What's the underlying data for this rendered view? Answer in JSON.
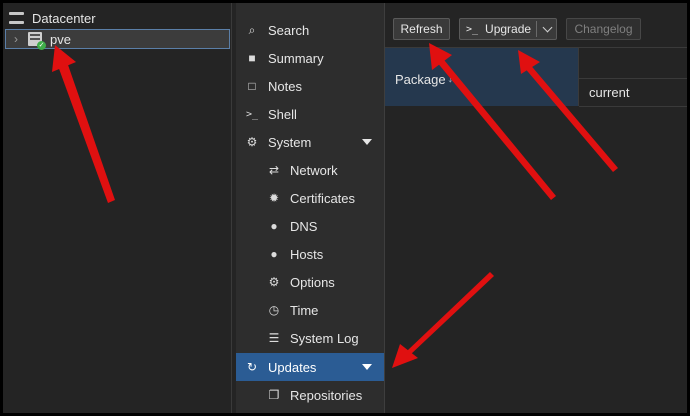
{
  "tree": {
    "datacenter_label": "Datacenter",
    "node_label": "pve",
    "expander_glyph": "›"
  },
  "nav": {
    "items": [
      {
        "label": "Search",
        "icon": "search-icon"
      },
      {
        "label": "Summary",
        "icon": "book-icon"
      },
      {
        "label": "Notes",
        "icon": "note-icon"
      },
      {
        "label": "Shell",
        "icon": "terminal-icon"
      },
      {
        "label": "System",
        "icon": "gears-icon"
      },
      {
        "label": "Network",
        "icon": "exchange-icon"
      },
      {
        "label": "Certificates",
        "icon": "certificate-icon"
      },
      {
        "label": "DNS",
        "icon": "globe-icon"
      },
      {
        "label": "Hosts",
        "icon": "globe-icon"
      },
      {
        "label": "Options",
        "icon": "gear-icon"
      },
      {
        "label": "Time",
        "icon": "clock-icon"
      },
      {
        "label": "System Log",
        "icon": "list-icon"
      },
      {
        "label": "Updates",
        "icon": "refresh-icon"
      },
      {
        "label": "Repositories",
        "icon": "files-icon"
      }
    ]
  },
  "toolbar": {
    "refresh_label": "Refresh",
    "upgrade_label": "Upgrade",
    "upgrade_prefix": ">_",
    "changelog_label": "Changelog"
  },
  "grid": {
    "package_header": "Package",
    "sort_glyph": "↓",
    "current_header": "current"
  },
  "colors": {
    "active_nav": "#2b5c94",
    "header_selected": "#25384e",
    "arrow": "#e01010",
    "status_ok": "#3fae49"
  }
}
